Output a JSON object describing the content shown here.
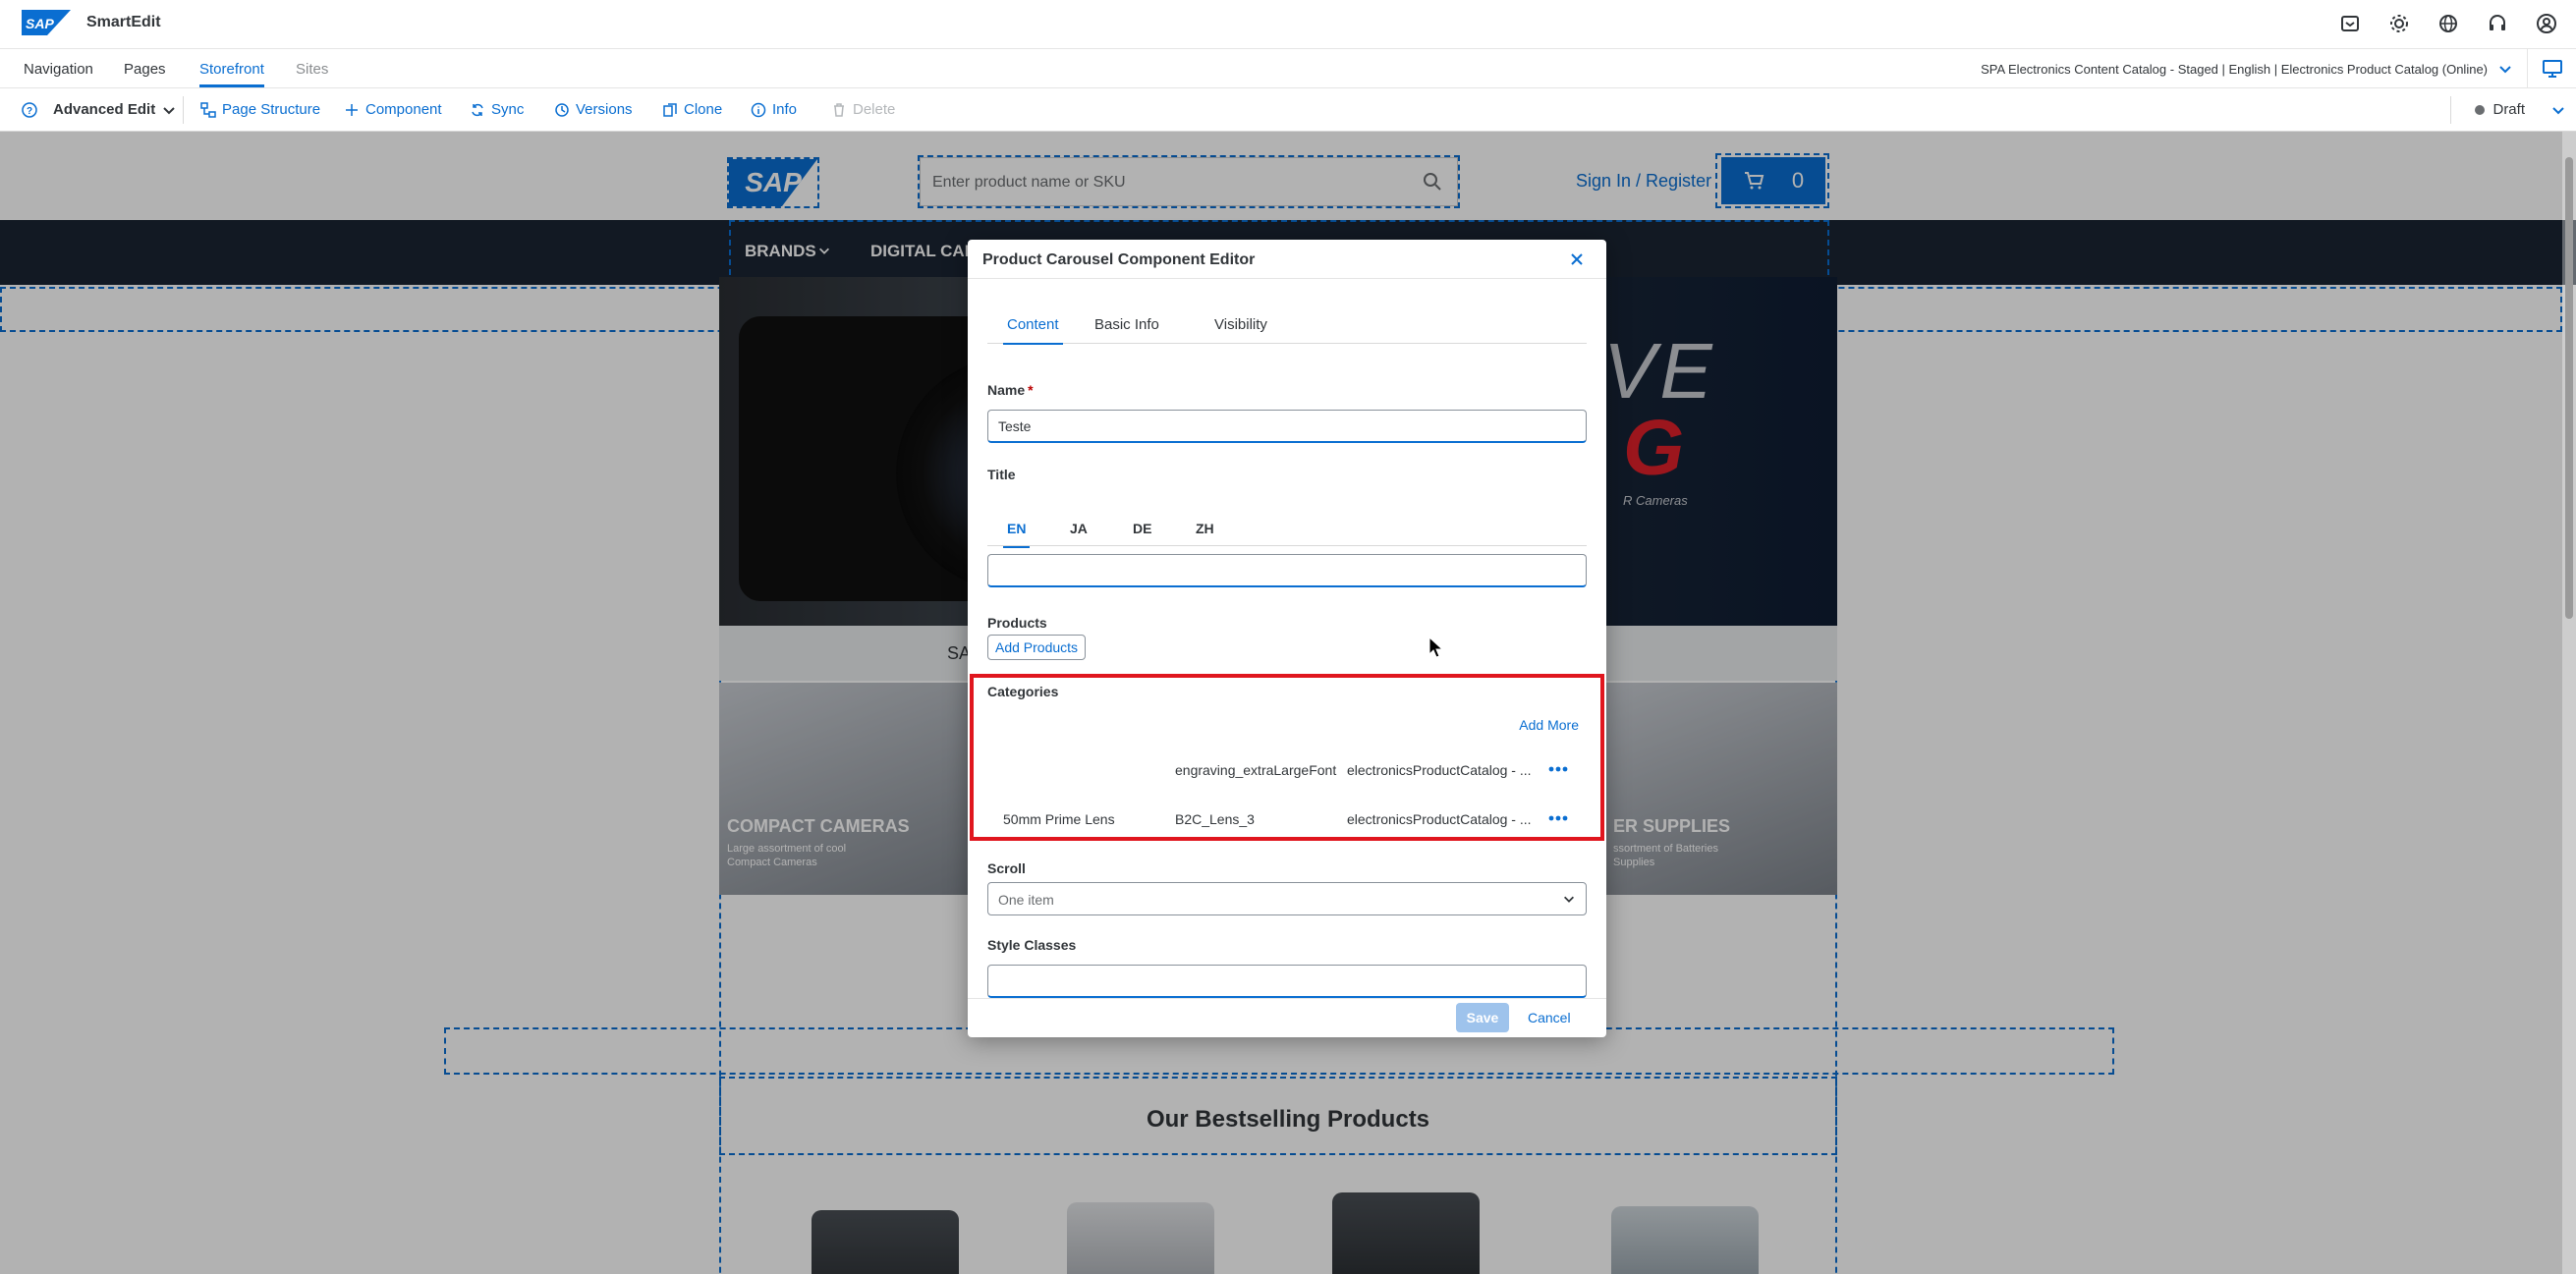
{
  "app": {
    "title": "SmartEdit",
    "logo_text": "SAP"
  },
  "nav": {
    "tabs": [
      {
        "label": "Navigation"
      },
      {
        "label": "Pages"
      },
      {
        "label": "Storefront"
      },
      {
        "label": "Sites"
      }
    ],
    "active_tab": "Storefront",
    "catalog_label": "SPA Electronics Content Catalog - Staged | English | Electronics Product Catalog (Online)"
  },
  "toolbar": {
    "mode_label": "Advanced Edit",
    "page_structure": "Page Structure",
    "component": "Component",
    "sync": "Sync",
    "versions": "Versions",
    "clone": "Clone",
    "info": "Info",
    "delete": "Delete",
    "status": "Draft"
  },
  "storefront": {
    "logo": "SAP",
    "search_placeholder": "Enter product name or SKU",
    "sign_in": "Sign In / Register",
    "cart_count": "0",
    "menu": [
      "BRANDS",
      "DIGITAL CAM"
    ],
    "hero_text": "VE",
    "hero_red": "G",
    "hero_small": "R Cameras",
    "strip_text": "SA",
    "tile_left_title": "COMPACT CAMERAS",
    "tile_left_sub1": "Large assortment of cool",
    "tile_left_sub2": "Compact Cameras",
    "tile_right_title": "ER SUPPLIES",
    "tile_right_sub1": "ssortment of Batteries",
    "tile_right_sub2": "Supplies",
    "bestselling": "Our Bestselling Products"
  },
  "modal": {
    "title": "Product Carousel Component Editor",
    "tabs": [
      {
        "label": "Content"
      },
      {
        "label": "Basic Info"
      },
      {
        "label": "Visibility"
      }
    ],
    "name_label": "Name",
    "name_value": "Teste",
    "title_label": "Title",
    "languages": [
      "EN",
      "JA",
      "DE",
      "ZH"
    ],
    "title_value": "",
    "products_label": "Products",
    "add_products": "Add Products",
    "categories_label": "Categories",
    "add_more": "Add More",
    "categories": [
      {
        "name": "",
        "code": "engraving_extraLargeFont",
        "catalog": "electronicsProductCatalog - ..."
      },
      {
        "name": "50mm Prime Lens",
        "code": "B2C_Lens_3",
        "catalog": "electronicsProductCatalog - ..."
      }
    ],
    "scroll_label": "Scroll",
    "scroll_value": "One item",
    "style_label": "Style Classes",
    "style_value": "",
    "save": "Save",
    "cancel": "Cancel"
  },
  "colors": {
    "accent": "#0a6ed1",
    "highlight": "#e0161e",
    "menu_bg": "#1a2433"
  }
}
